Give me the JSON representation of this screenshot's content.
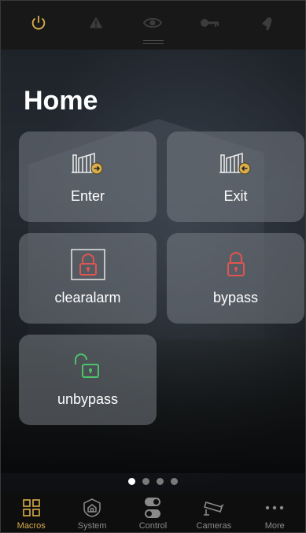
{
  "topbar": {
    "icons": [
      "power-icon",
      "warning-icon",
      "eye-icon",
      "key-icon",
      "alarm-bell-icon"
    ],
    "active_color": "#d9ad4a"
  },
  "page": {
    "title": "Home"
  },
  "tiles": [
    {
      "label": "Enter",
      "icon": "gate-enter-icon"
    },
    {
      "label": "Exit",
      "icon": "gate-exit-icon"
    },
    {
      "label": "clearalarm",
      "icon": "padlock-locked-icon",
      "icon_color": "#e0554f"
    },
    {
      "label": "bypass",
      "icon": "padlock-locked-icon",
      "icon_color": "#e0554f"
    },
    {
      "label": "unbypass",
      "icon": "padlock-unlocked-icon",
      "icon_color": "#4cc46a"
    }
  ],
  "pager": {
    "pages": 4,
    "current": 1
  },
  "tabbar": {
    "items": [
      {
        "label": "Macros",
        "icon": "grid-icon"
      },
      {
        "label": "System",
        "icon": "house-shield-icon"
      },
      {
        "label": "Control",
        "icon": "toggle-icon"
      },
      {
        "label": "Cameras",
        "icon": "camera-icon"
      },
      {
        "label": "More",
        "icon": "more-dots-icon"
      }
    ],
    "active": "Macros",
    "active_color": "#d9ad4a",
    "inactive_color": "#8a8a8a"
  }
}
